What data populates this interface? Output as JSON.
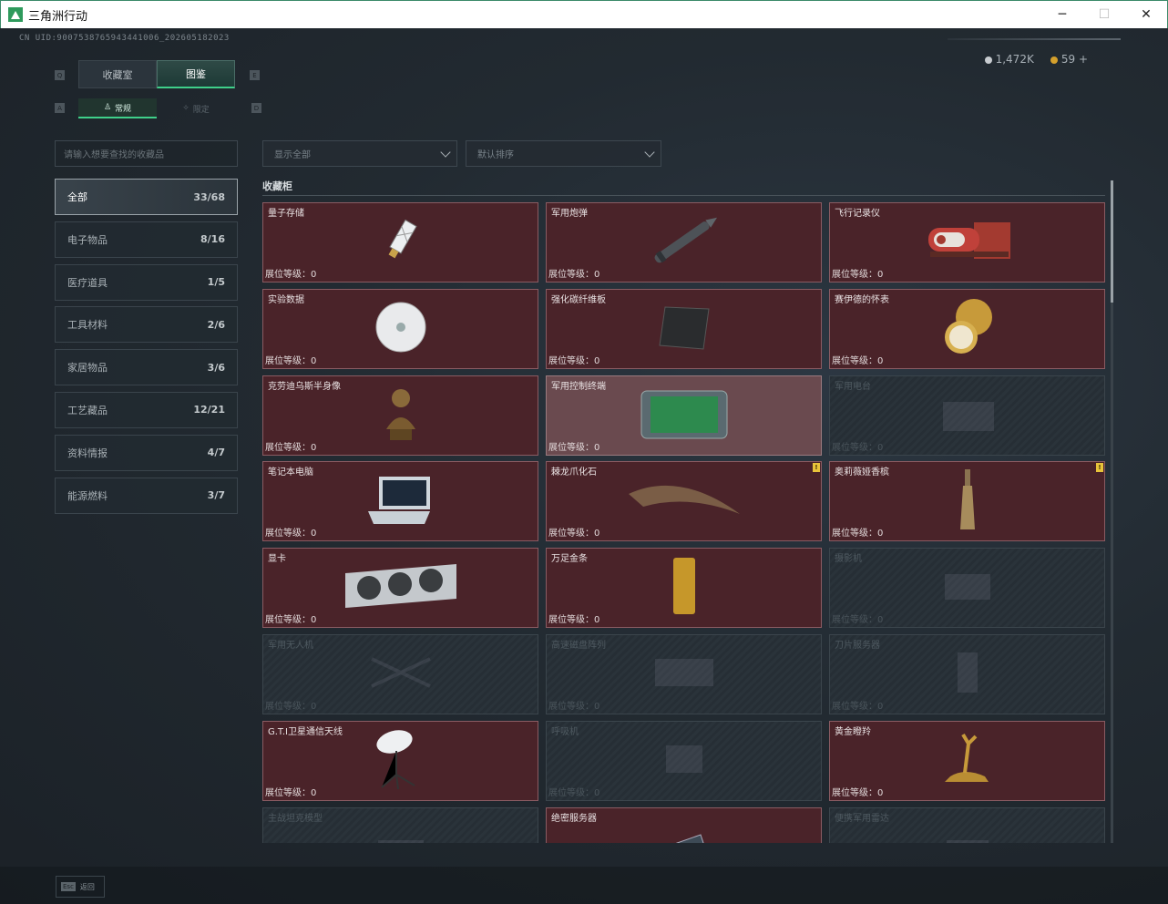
{
  "window": {
    "title": "三角洲行动",
    "minimize": "─",
    "maximize": "☐",
    "close": "✕"
  },
  "header": {
    "uid": "CN UID:9007538765943441006_202605182023",
    "silver_amount": "1,472K",
    "gold_amount": "59",
    "add_label": "+"
  },
  "keys": {
    "q": "Q",
    "e": "E",
    "a": "A",
    "d": "D"
  },
  "tabs": [
    {
      "label": "收藏室",
      "active": false
    },
    {
      "label": "图鉴",
      "active": true
    }
  ],
  "subtabs": [
    {
      "label": "常规",
      "icon": "person-icon",
      "active": true
    },
    {
      "label": "限定",
      "icon": "stars-icon",
      "active": false
    }
  ],
  "search": {
    "placeholder": "请输入想要查找的收藏品"
  },
  "filters": {
    "display": "显示全部",
    "sort": "默认排序"
  },
  "categories": [
    {
      "label": "全部",
      "count": "33/68",
      "active": true
    },
    {
      "label": "电子物品",
      "count": "8/16"
    },
    {
      "label": "医疗道具",
      "count": "1/5"
    },
    {
      "label": "工具材料",
      "count": "2/6"
    },
    {
      "label": "家居物品",
      "count": "3/6"
    },
    {
      "label": "工艺藏品",
      "count": "12/21"
    },
    {
      "label": "资料情报",
      "count": "4/7"
    },
    {
      "label": "能源燃料",
      "count": "3/7"
    }
  ],
  "section": {
    "title": "收藏柜"
  },
  "items": [
    {
      "name": "量子存储",
      "level": "展位等级：0",
      "locked": false,
      "art": "usb-drive-icon"
    },
    {
      "name": "军用炮弹",
      "level": "展位等级：0",
      "locked": false,
      "art": "artillery-shell-icon"
    },
    {
      "name": "飞行记录仪",
      "level": "展位等级：0",
      "locked": false,
      "art": "flight-recorder-icon"
    },
    {
      "name": "实验数据",
      "level": "展位等级：0",
      "locked": false,
      "art": "disc-icon"
    },
    {
      "name": "强化碳纤维板",
      "level": "展位等级：0",
      "locked": false,
      "art": "carbon-plate-icon"
    },
    {
      "name": "赛伊德的怀表",
      "level": "展位等级：0",
      "locked": false,
      "art": "pocket-watch-icon"
    },
    {
      "name": "克劳迪乌斯半身像",
      "level": "展位等级：0",
      "locked": false,
      "art": "bust-icon"
    },
    {
      "name": "军用控制终端",
      "level": "展位等级：0",
      "locked": false,
      "highlight": true,
      "art": "control-terminal-icon"
    },
    {
      "name": "军用电台",
      "level": "展位等级：0",
      "locked": true,
      "art": "radio-icon"
    },
    {
      "name": "笔记本电脑",
      "level": "展位等级：0",
      "locked": false,
      "art": "laptop-icon"
    },
    {
      "name": "棘龙爪化石",
      "level": "展位等级：0",
      "locked": false,
      "badge": "!",
      "art": "claw-fossil-icon"
    },
    {
      "name": "奥莉薇娅香槟",
      "level": "展位等级：0",
      "locked": false,
      "badge": "!",
      "art": "champagne-icon"
    },
    {
      "name": "显卡",
      "level": "展位等级：0",
      "locked": false,
      "art": "graphics-card-icon"
    },
    {
      "name": "万足金条",
      "level": "展位等级：0",
      "locked": false,
      "art": "gold-bar-icon"
    },
    {
      "name": "摄影机",
      "level": "展位等级：0",
      "locked": true,
      "art": "camera-icon"
    },
    {
      "name": "军用无人机",
      "level": "展位等级：0",
      "locked": true,
      "art": "drone-icon"
    },
    {
      "name": "高速磁盘阵列",
      "level": "展位等级：0",
      "locked": true,
      "art": "disk-array-icon"
    },
    {
      "name": "刀片服务器",
      "level": "展位等级：0",
      "locked": true,
      "art": "blade-server-icon"
    },
    {
      "name": "G.T.I卫星通信天线",
      "level": "展位等级：0",
      "locked": false,
      "art": "satellite-dish-icon"
    },
    {
      "name": "呼吸机",
      "level": "展位等级：0",
      "locked": true,
      "art": "ventilator-icon"
    },
    {
      "name": "黄金瞪羚",
      "level": "展位等级：0",
      "locked": false,
      "art": "gold-gazelle-icon"
    },
    {
      "name": "主战坦克模型",
      "level": "",
      "locked": true,
      "art": "tank-model-icon"
    },
    {
      "name": "绝密服务器",
      "level": "",
      "locked": false,
      "art": "server-icon"
    },
    {
      "name": "便携军用雷达",
      "level": "",
      "locked": true,
      "art": "radar-icon"
    }
  ],
  "footer": {
    "esc_key": "Esc",
    "esc_label": "返回"
  },
  "colors": {
    "accent": "#3fd08a",
    "card_owned": "#4a2329",
    "card_locked": "#262e35",
    "badge": "#e8c33a"
  }
}
